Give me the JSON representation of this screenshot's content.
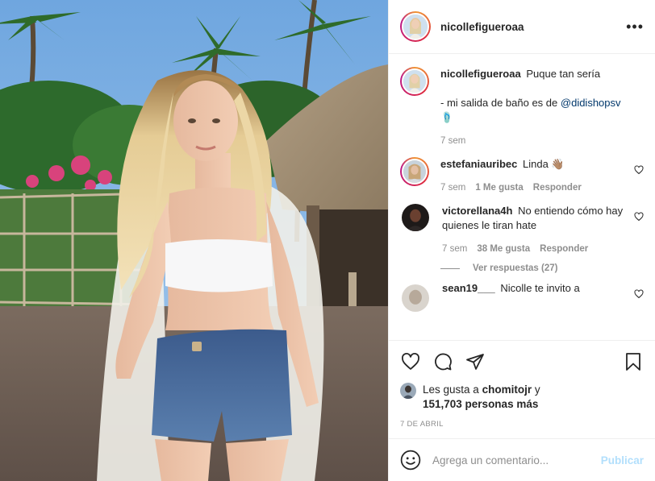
{
  "post": {
    "username": "nicollefigueroaa",
    "more_icon": "more-horizontal-icon",
    "caption": {
      "username": "nicollefigueroaa",
      "line1": "Puque tan sería",
      "line2_prefix": "- mi salida de baño es de",
      "mention": "@didishopsv",
      "line3": "🩴",
      "time": "7 sem"
    },
    "comments": [
      {
        "username": "estefaniauribec",
        "text": "Linda 👋🏽",
        "time": "7 sem",
        "likes": "1 Me gusta",
        "reply": "Responder"
      },
      {
        "username": "victorellana4h",
        "text": "No entiendo cómo hay quienes le tiran hate",
        "time": "7 sem",
        "likes": "38 Me gusta",
        "reply": "Responder",
        "view_replies": "Ver respuestas (27)"
      },
      {
        "username": "sean19___",
        "text": "Nicolle te invito a"
      }
    ],
    "actions": {
      "like_icon": "heart-icon",
      "comment_icon": "comment-icon",
      "share_icon": "share-icon",
      "save_icon": "bookmark-icon"
    },
    "likes": {
      "prefix": "Les gusta a",
      "user": "chomitojr",
      "joiner": "y",
      "count": "151,703 personas más"
    },
    "date": "7 DE ABRIL",
    "add_comment": {
      "placeholder": "Agrega un comentario...",
      "publish": "Publicar",
      "emoji_icon": "emoji-icon"
    }
  }
}
